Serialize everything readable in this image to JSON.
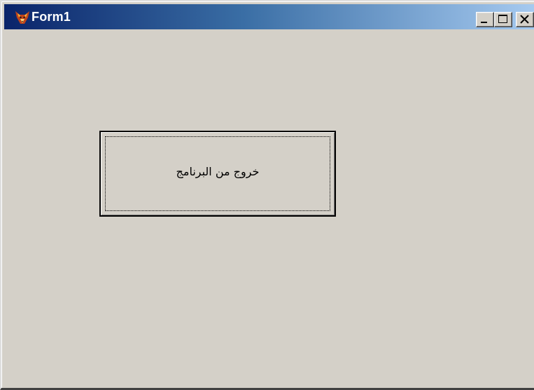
{
  "window": {
    "title": "Form1",
    "icon": "fox-app-icon",
    "caption_buttons": {
      "minimize": "minimize-icon",
      "maximize": "maximize-icon",
      "close": "close-icon"
    }
  },
  "form": {
    "exit_button_label": "خروج من البرنامج"
  },
  "colors": {
    "title_gradient_start": "#0a246a",
    "title_gradient_end": "#a6caf0",
    "face": "#d4d0c8"
  }
}
